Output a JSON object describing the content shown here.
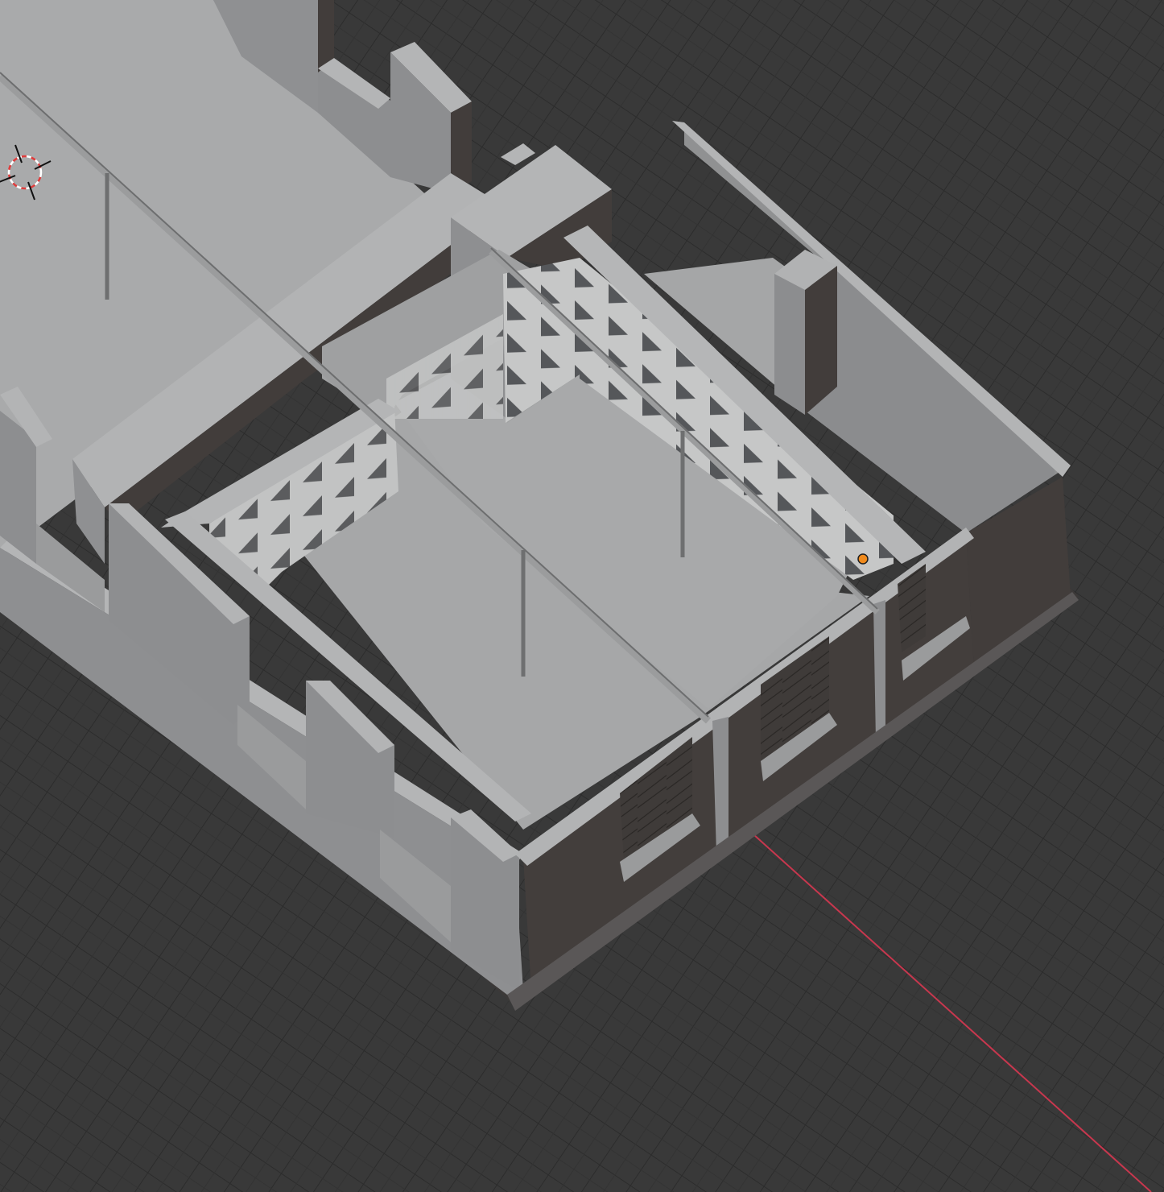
{
  "viewport": {
    "type": "3d-viewport",
    "background": "#393939",
    "grid_line_color": "#2e2e2e",
    "grid_major_color": "#262626",
    "x_axis_color": "#c8374e",
    "model": {
      "floor_color": "#a7a8a9",
      "wall_top_color": "#b2b3b4",
      "wall_light_face": "#8e8f91",
      "wall_dark_face": "#423d3b",
      "edge_color": "#6b6b6b",
      "shelf_light": "#c9caca",
      "shelf_shadow": "#5a5b5c"
    },
    "origin_marker_color": "#f08a1c",
    "cursor_icon": "3d-cursor-icon"
  }
}
